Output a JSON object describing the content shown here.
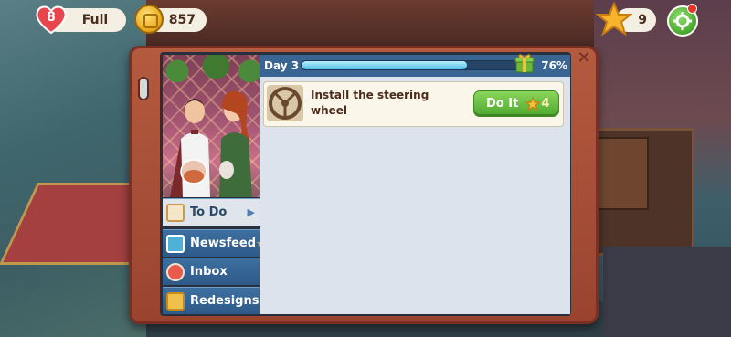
{
  "hud": {
    "lives": "8",
    "lives_status": "Full",
    "coins": "857",
    "stars": "9"
  },
  "journal": {
    "day_label": "Day 3",
    "progress": 0.76,
    "progress_label": "76%",
    "tabs": [
      {
        "label": "To Do",
        "icon": "todo-icon",
        "active": true
      },
      {
        "label": "Newsfeed",
        "icon": "newsfeed-icon",
        "active": false
      },
      {
        "label": "Inbox",
        "icon": "inbox-icon",
        "active": false
      },
      {
        "label": "Redesigns",
        "icon": "redesigns-icon",
        "active": false
      }
    ],
    "task": {
      "label": "Install the steering wheel",
      "icon": "steering-wheel-icon",
      "button_label": "Do It",
      "star_cost": "4"
    }
  },
  "colors": {
    "progress_fill": "#4fbde3",
    "do_it_button": "#4ea82f",
    "journal_cover": "#b45a3f",
    "tab_blue": "#2d5a88"
  }
}
